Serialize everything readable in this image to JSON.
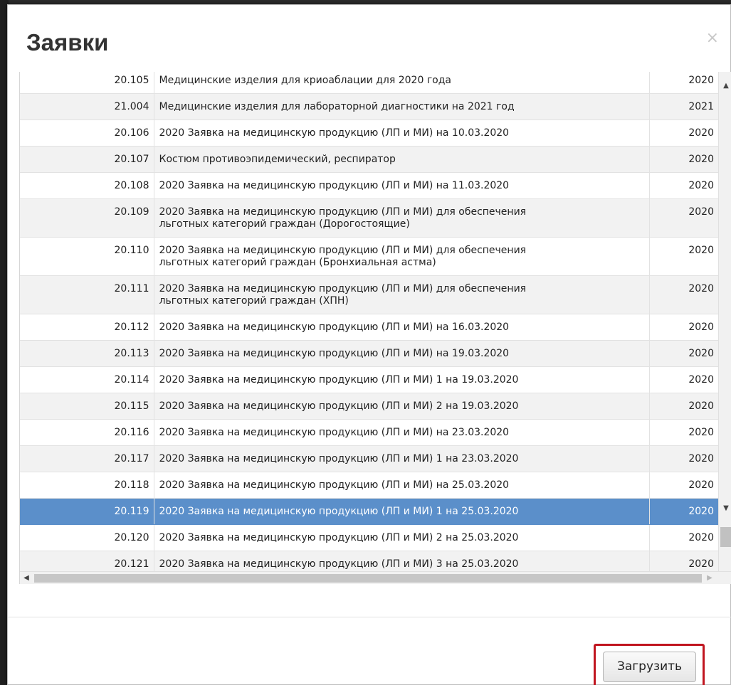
{
  "dialog": {
    "title": "Заявки",
    "close_icon": "×",
    "load_button": "Загрузить"
  },
  "rows": [
    {
      "code": "20.105",
      "name": "Медицинские изделия для криоаблации для 2020 года",
      "year": "2020",
      "alt": false,
      "selected": false
    },
    {
      "code": "21.004",
      "name": "Медицинские изделия для лабораторной диагностики на 2021 год",
      "year": "2021",
      "alt": true,
      "selected": false
    },
    {
      "code": "20.106",
      "name": "2020 Заявка на медицинскую продукцию (ЛП и МИ) на 10.03.2020",
      "year": "2020",
      "alt": false,
      "selected": false
    },
    {
      "code": "20.107",
      "name": "Костюм противоэпидемический, респиратор",
      "year": "2020",
      "alt": true,
      "selected": false
    },
    {
      "code": "20.108",
      "name": "2020 Заявка на медицинскую продукцию (ЛП и МИ) на 11.03.2020",
      "year": "2020",
      "alt": false,
      "selected": false
    },
    {
      "code": "20.109",
      "name": "2020 Заявка на медицинскую продукцию (ЛП и МИ) для обеспечения\nльготных категорий граждан (Дорогостоящие)",
      "year": "2020",
      "alt": true,
      "selected": false
    },
    {
      "code": "20.110",
      "name": "2020 Заявка на медицинскую продукцию (ЛП и МИ) для обеспечения\nльготных категорий граждан (Бронхиальная астма)",
      "year": "2020",
      "alt": false,
      "selected": false
    },
    {
      "code": "20.111",
      "name": "2020 Заявка на медицинскую продукцию (ЛП и МИ) для обеспечения\nльготных категорий граждан (ХПН)",
      "year": "2020",
      "alt": true,
      "selected": false
    },
    {
      "code": "20.112",
      "name": "2020 Заявка на медицинскую продукцию (ЛП и МИ) на 16.03.2020",
      "year": "2020",
      "alt": false,
      "selected": false
    },
    {
      "code": "20.113",
      "name": "2020 Заявка на медицинскую продукцию (ЛП и МИ) на 19.03.2020",
      "year": "2020",
      "alt": true,
      "selected": false
    },
    {
      "code": "20.114",
      "name": "2020 Заявка на медицинскую продукцию (ЛП и МИ) 1 на 19.03.2020",
      "year": "2020",
      "alt": false,
      "selected": false
    },
    {
      "code": "20.115",
      "name": "2020 Заявка на медицинскую продукцию (ЛП и МИ) 2 на 19.03.2020",
      "year": "2020",
      "alt": true,
      "selected": false
    },
    {
      "code": "20.116",
      "name": "2020 Заявка на медицинскую продукцию (ЛП и МИ) на 23.03.2020",
      "year": "2020",
      "alt": false,
      "selected": false
    },
    {
      "code": "20.117",
      "name": "2020 Заявка на медицинскую продукцию (ЛП и МИ) 1 на 23.03.2020",
      "year": "2020",
      "alt": true,
      "selected": false
    },
    {
      "code": "20.118",
      "name": "2020 Заявка на медицинскую продукцию (ЛП и МИ) на 25.03.2020",
      "year": "2020",
      "alt": false,
      "selected": false
    },
    {
      "code": "20.119",
      "name": "2020 Заявка на медицинскую продукцию (ЛП и МИ) 1 на 25.03.2020",
      "year": "2020",
      "alt": false,
      "selected": true
    },
    {
      "code": "20.120",
      "name": "2020 Заявка на медицинскую продукцию (ЛП и МИ) 2 на 25.03.2020",
      "year": "2020",
      "alt": false,
      "selected": false
    },
    {
      "code": "20.121",
      "name": "2020 Заявка на медицинскую продукцию (ЛП и МИ) 3 на 25.03.2020",
      "year": "2020",
      "alt": true,
      "selected": false
    }
  ],
  "scrollbars": {
    "up_icon": "▲",
    "down_icon": "▼",
    "left_icon": "◀",
    "right_icon": "▶"
  },
  "colors": {
    "selected_row": "#5b8fca",
    "highlight_border": "#c0151f"
  }
}
